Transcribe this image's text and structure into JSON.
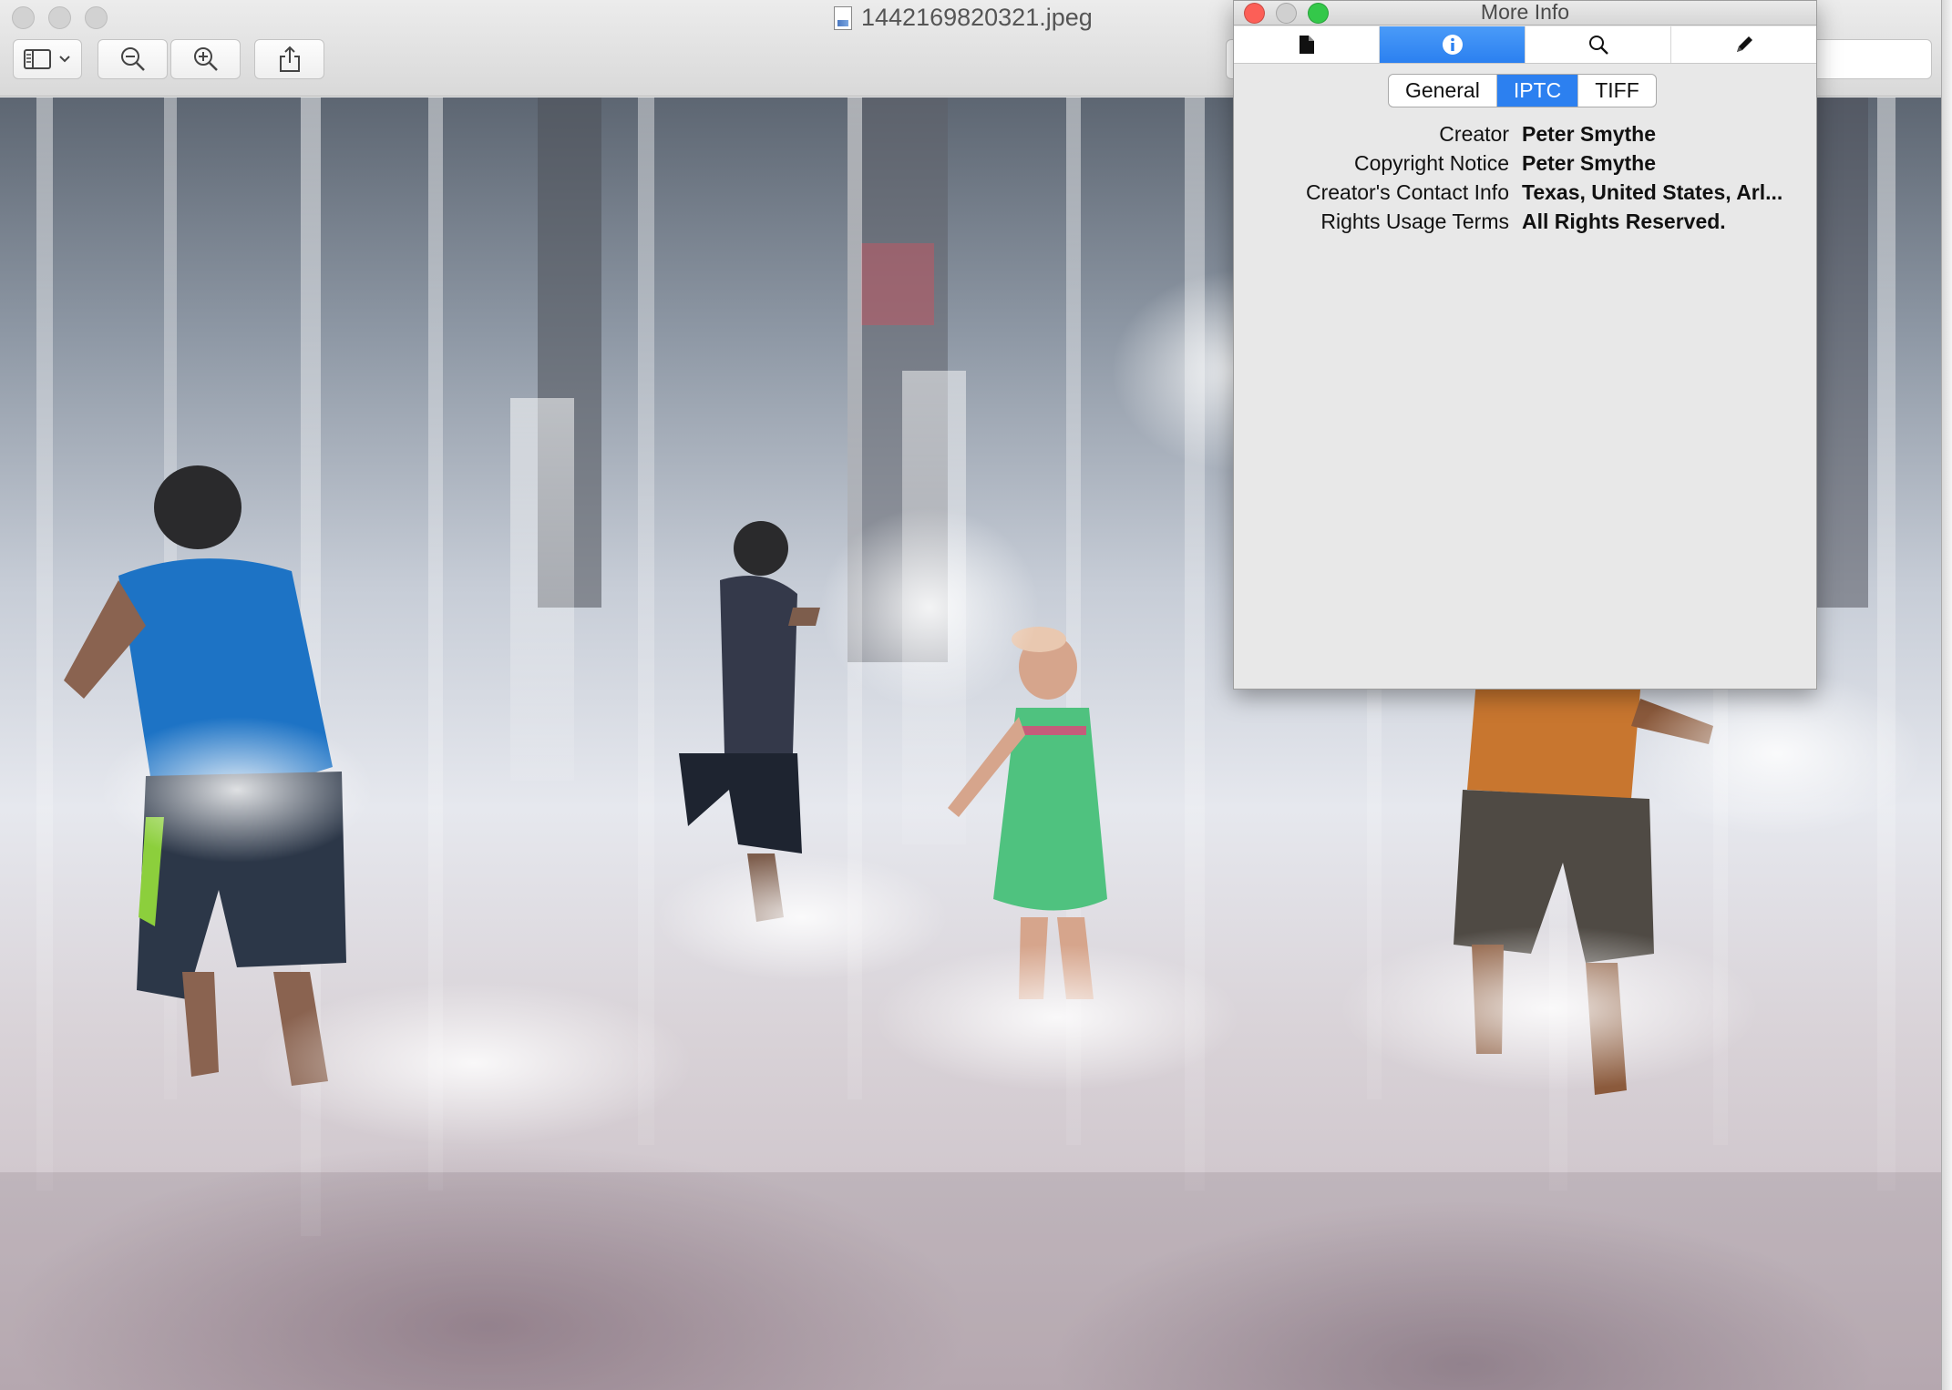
{
  "window": {
    "title": "1442169820321.jpeg",
    "icon": "jpeg-document-icon"
  },
  "toolbar": {
    "sidebar_icon": "sidebar-icon",
    "zoom_out_icon": "zoom-out-icon",
    "zoom_in_icon": "zoom-in-icon",
    "share_icon": "share-icon"
  },
  "photo": {
    "description_icon": "photo-image"
  },
  "more_info": {
    "title": "More Info",
    "tabs": [
      {
        "icon": "file-icon",
        "active": false
      },
      {
        "icon": "info-icon",
        "active": true
      },
      {
        "icon": "search-icon",
        "active": false
      },
      {
        "icon": "pencil-icon",
        "active": false
      }
    ],
    "segments": [
      "General",
      "IPTC",
      "TIFF"
    ],
    "selected_segment": "IPTC",
    "rows": [
      {
        "key": "Creator",
        "value": "Peter Smythe"
      },
      {
        "key": "Copyright Notice",
        "value": "Peter Smythe"
      },
      {
        "key": "Creator's Contact Info",
        "value": "Texas, United States, Arl..."
      },
      {
        "key": "Rights Usage Terms",
        "value": "All Rights Reserved."
      }
    ]
  },
  "colors": {
    "accent": "#2c80f0",
    "close": "#fc5f57",
    "zoom": "#34c84a"
  }
}
